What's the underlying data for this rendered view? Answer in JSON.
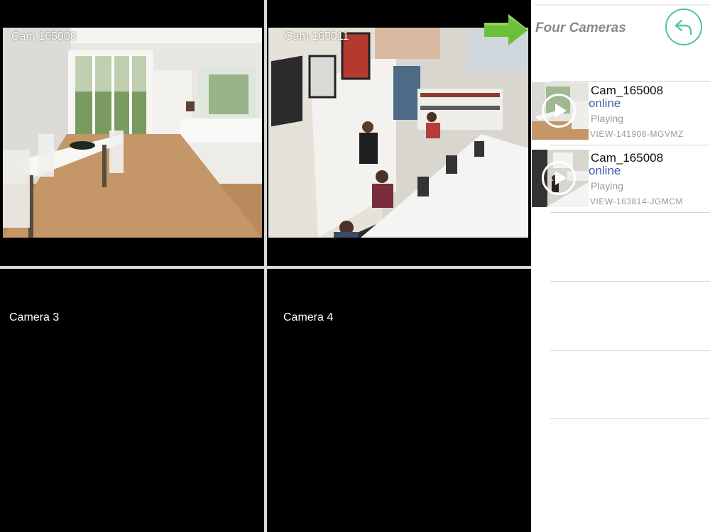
{
  "grid": {
    "cells": [
      {
        "label": "Cam 165008",
        "has_feed": true
      },
      {
        "label": "Cam 165011",
        "has_feed": true
      },
      {
        "label": "Camera 3",
        "has_feed": false
      },
      {
        "label": "Camera 4",
        "has_feed": false
      }
    ]
  },
  "panel": {
    "title": "Four Cameras",
    "back_icon": "back-arrow-icon",
    "cameras": [
      {
        "name": "Cam_165008",
        "status": "online",
        "state": "Playing",
        "view_id": "VIEW-141908-MGVMZ"
      },
      {
        "name": "Cam_165008",
        "status": "online",
        "state": "Playing",
        "view_id": "VIEW-163814-JGMCM"
      }
    ]
  },
  "colors": {
    "accent": "#4cc59a",
    "status_online": "#3a5fa8",
    "arrow": "#6cbf3a"
  }
}
